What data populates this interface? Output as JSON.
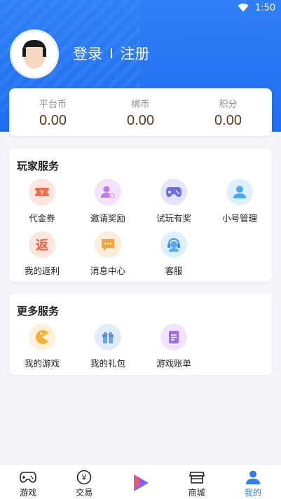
{
  "status_bar": {
    "time": "1:50"
  },
  "user": {
    "login_label": "登录",
    "register_label": "注册"
  },
  "currencies": [
    {
      "label": "平台币",
      "value": "0.00"
    },
    {
      "label": "绑币",
      "value": "0.00"
    },
    {
      "label": "积分",
      "value": "0.00"
    }
  ],
  "player_services": {
    "title": "玩家服务",
    "items": [
      {
        "label": "代金券",
        "icon": "voucher-icon"
      },
      {
        "label": "邀请奖励",
        "icon": "invite-icon"
      },
      {
        "label": "试玩有奖",
        "icon": "gamepad-icon"
      },
      {
        "label": "小号管理",
        "icon": "account-icon"
      },
      {
        "label": "我的返利",
        "icon": "rebate-icon",
        "glyph": "返"
      },
      {
        "label": "消息中心",
        "icon": "message-icon"
      },
      {
        "label": "客服",
        "icon": "customer-service-icon"
      }
    ]
  },
  "more_services": {
    "title": "更多服务",
    "items": [
      {
        "label": "我的游戏",
        "icon": "my-games-icon"
      },
      {
        "label": "我的礼包",
        "icon": "gift-icon"
      },
      {
        "label": "游戏账单",
        "icon": "bill-icon"
      }
    ]
  },
  "bottom_nav": [
    {
      "label": "游戏",
      "icon": "game-controller-icon"
    },
    {
      "label": "交易",
      "icon": "trade-icon",
      "glyph": "¥"
    },
    {
      "label": "",
      "icon": "play-logo-icon"
    },
    {
      "label": "商城",
      "icon": "store-icon"
    },
    {
      "label": "我的",
      "icon": "profile-icon",
      "active": true
    }
  ],
  "colors": {
    "primary": "#2e7cf6",
    "currency_value": "#5b3a1a"
  }
}
